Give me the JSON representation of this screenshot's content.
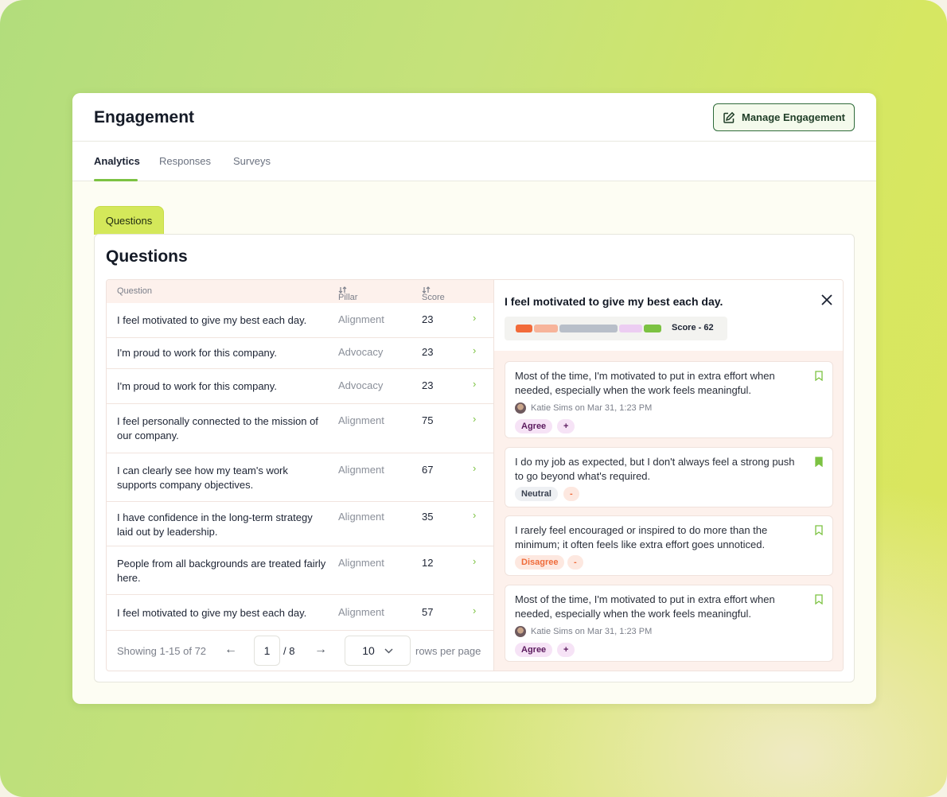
{
  "header": {
    "title": "Engagement",
    "manage_label": "Manage Engagement"
  },
  "tabs": [
    "Analytics",
    "Responses",
    "Surveys"
  ],
  "section_tab": "Questions",
  "panel_title": "Questions",
  "table": {
    "columns": [
      "Question",
      "Pillar",
      "Score"
    ],
    "rows": [
      {
        "question": "I feel motivated to give my best each day.",
        "pillar": "Alignment",
        "score": "23"
      },
      {
        "question": "I'm proud to work for this company.",
        "pillar": "Advocacy",
        "score": "23"
      },
      {
        "question": "I'm proud to work for this company.",
        "pillar": "Advocacy",
        "score": "23"
      },
      {
        "question": "I feel personally connected to the mission of our company.",
        "pillar": "Alignment",
        "score": "75"
      },
      {
        "question": "I can clearly see how my team's work supports company objectives.",
        "pillar": "Alignment",
        "score": "67"
      },
      {
        "question": "I have confidence in the long-term strategy laid out by leadership.",
        "pillar": "Alignment",
        "score": "35"
      },
      {
        "question": "People from all backgrounds are treated fairly here.",
        "pillar": "Alignment",
        "score": "12"
      },
      {
        "question": "I feel motivated to give my best each day.",
        "pillar": "Alignment",
        "score": "57"
      }
    ],
    "footer": {
      "showing": "Showing 1-15 of 72",
      "page": "1",
      "total_pages": "/ 8",
      "rows_per_page_value": "10",
      "rows_per_page_label": "rows per page"
    }
  },
  "detail": {
    "title": "I feel motivated to give my best each day.",
    "score_label": "Score - 62",
    "score_colors": [
      "#f26b3a",
      "#f7b49a",
      "#b8bfc9",
      "#eccdf2",
      "#7cc242"
    ],
    "responses": [
      {
        "text": "Most of the time, I'm motivated to put in extra effort when needed, especially when the work feels meaningful.",
        "author": "Katie Sims on Mar 31, 1:23 PM",
        "tag": "Agree",
        "extra": "+",
        "bookmarked": false
      },
      {
        "text": "I do my job as expected, but I don't always feel a strong push to go beyond what's required.",
        "author": "",
        "tag": "Neutral",
        "extra": "-",
        "bookmarked": true
      },
      {
        "text": "I rarely feel encouraged or inspired to do more than the minimum; it often feels like extra effort goes unnoticed.",
        "author": "",
        "tag": "Disagree",
        "extra": "-",
        "bookmarked": false
      },
      {
        "text": "Most of the time, I'm motivated to put in extra effort when needed, especially when the work feels meaningful.",
        "author": "Katie Sims on Mar 31, 1:23 PM",
        "tag": "Agree",
        "extra": "+",
        "bookmarked": false
      }
    ]
  },
  "colors": {
    "accent": "#7cc242",
    "section_tab": "#d4e85a",
    "agree_bg": "#f6e3f6",
    "agree_text": "#5b1a5e",
    "neutral_bg": "#eef0f3",
    "neutral_text": "#3a4150",
    "disagree_bg": "#fde8e0",
    "disagree_text": "#ef6b3a"
  },
  "icons": {
    "manage": "edit-square-icon",
    "row": "chevron-right-icon",
    "close": "close-icon",
    "bookmark": "bookmark-icon",
    "prev": "arrow-left-icon",
    "next": "arrow-right-icon",
    "dropdown": "chevron-down-icon",
    "sort": "sort-icon"
  }
}
